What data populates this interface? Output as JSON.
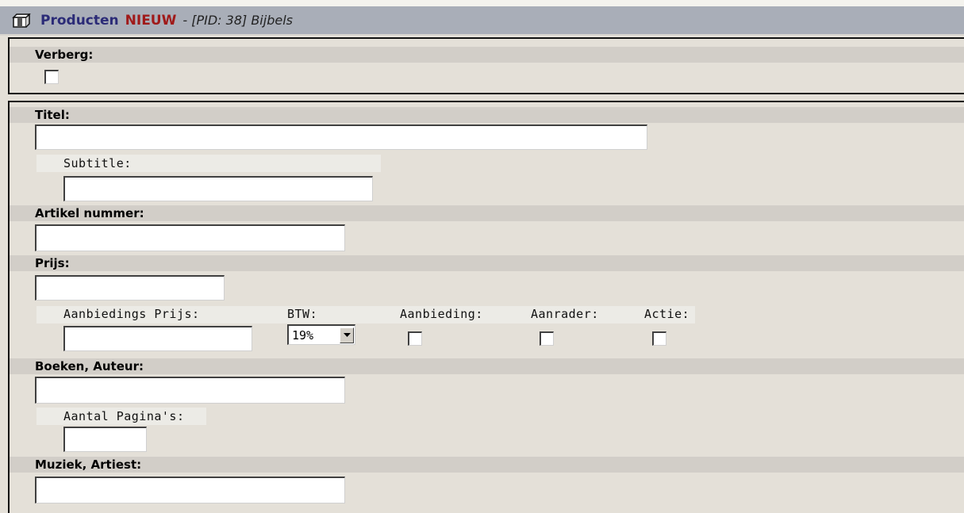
{
  "header": {
    "module": "Producten",
    "badge": "NIEUW",
    "context": "- [PID: 38] Bijbels",
    "icon": "box-icon"
  },
  "fields": {
    "verberg_label": "Verberg:",
    "titel_label": "Titel:",
    "titel_value": "",
    "subtitle_label": "Subtitle:",
    "subtitle_value": "",
    "artikel_label": "Artikel nummer:",
    "artikel_value": "",
    "prijs_label": "Prijs:",
    "prijs_value": "",
    "aanbiedings_prijs_label": "Aanbiedings Prijs:",
    "aanbiedings_prijs_value": "",
    "btw_label": "BTW:",
    "btw_value": "19%",
    "aanbieding_label": "Aanbieding:",
    "aanrader_label": "Aanrader:",
    "actie_label": "Actie:",
    "boeken_label": "Boeken, Auteur:",
    "boeken_value": "",
    "pagina_label": "Aantal Pagina's:",
    "pagina_value": "",
    "muziek_label": "Muziek, Artiest:",
    "muziek_value": ""
  },
  "colors": {
    "titlebar_bg": "#a9aeb8",
    "module_text": "#2b2b77",
    "badge_text": "#a01a1a",
    "section_bg": "#e4e0d8",
    "header_row_bg": "#d2cec8"
  }
}
